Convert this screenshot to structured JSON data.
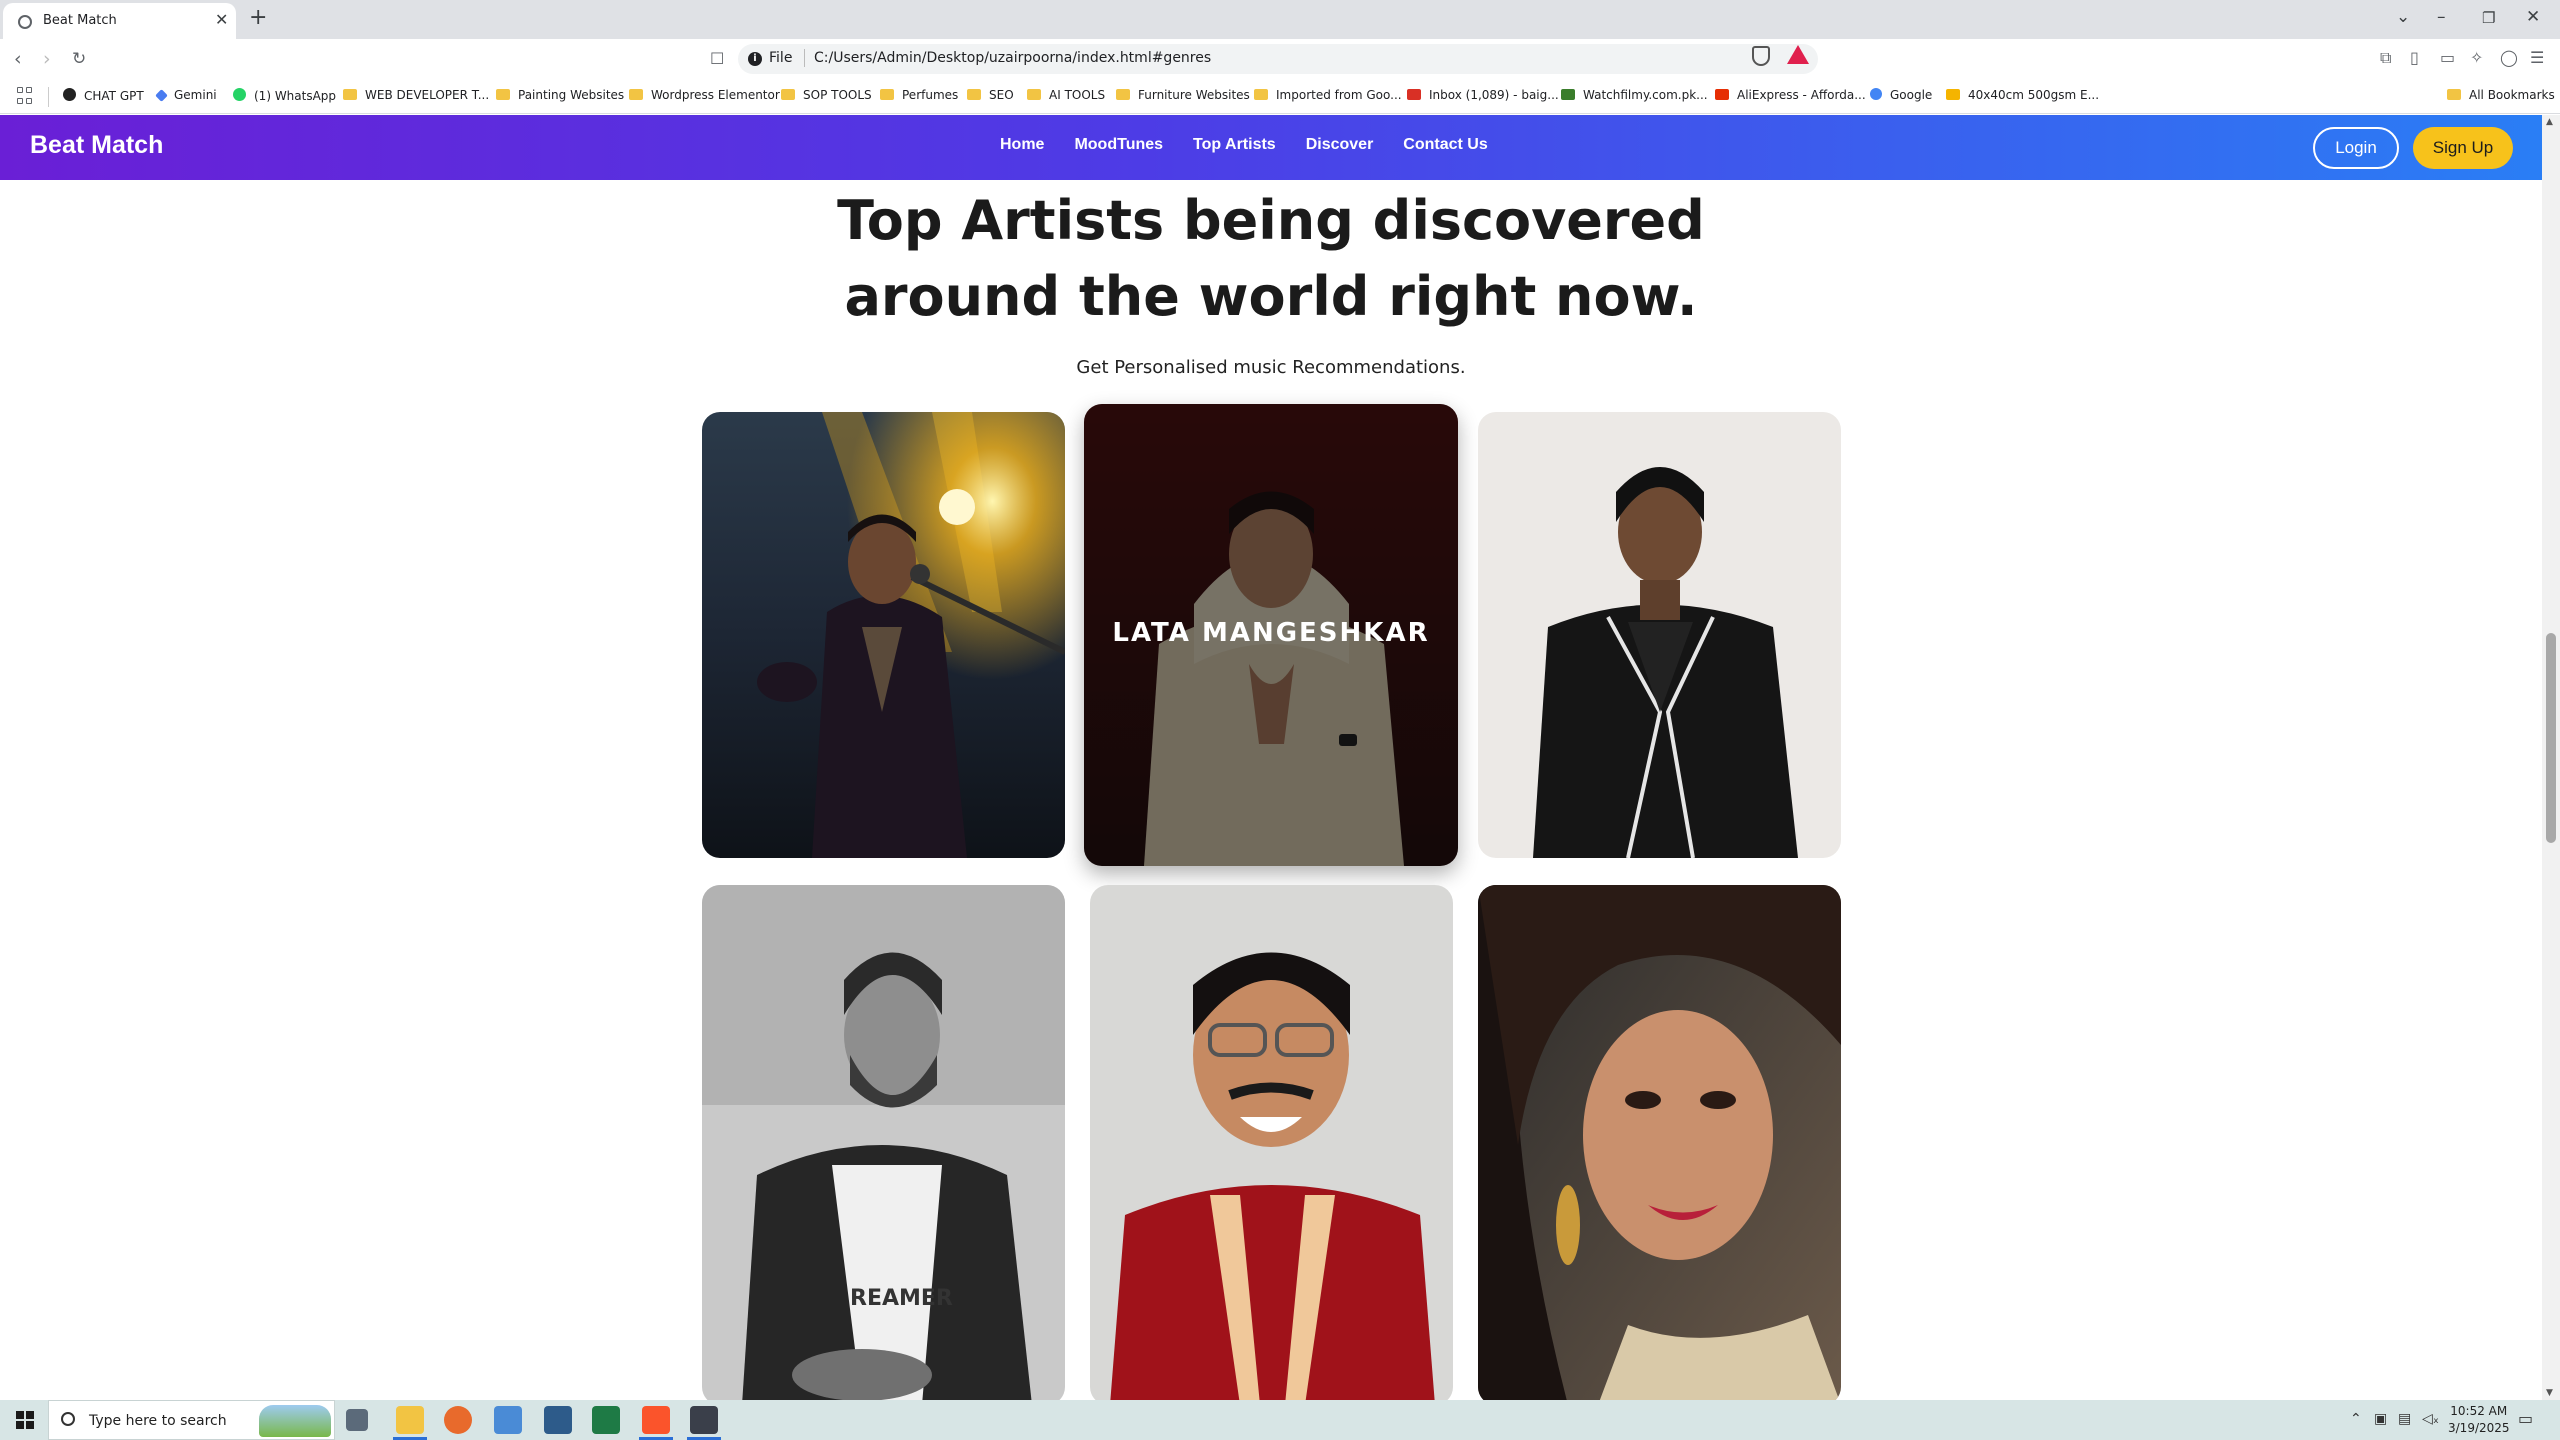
{
  "browser": {
    "tab_title": "Beat Match",
    "address_scheme": "File",
    "url": "C:/Users/Admin/Desktop/uzairpoorna/index.html#genres",
    "bookmarks": [
      "CHAT GPT",
      "Gemini",
      "(1) WhatsApp",
      "WEB DEVELOPER T...",
      "Painting Websites",
      "Wordpress Elementor",
      "SOP TOOLS",
      "Perfumes",
      "SEO",
      "AI TOOLS",
      "Furniture Websites",
      "Imported from Goo...",
      "Inbox (1,089) - baig...",
      "Watchfilmy.com.pk...",
      "AliExpress - Afforda...",
      "Google",
      "40x40cm 500gsm E..."
    ],
    "all_bookmarks": "All Bookmarks"
  },
  "site": {
    "brand": "Beat Match",
    "nav": [
      "Home",
      "MoodTunes",
      "Top Artists",
      "Discover",
      "Contact Us"
    ],
    "login": "Login",
    "signup": "Sign Up",
    "headline_line1": "Top Artists being discovered",
    "headline_line2": "around the world right now.",
    "subheading": "Get Personalised music Recommendations.",
    "hover_caption": "LATA MANGESHKAR",
    "colors": {
      "nav_gradient_start": "#6a1fd6",
      "nav_gradient_end": "#2a7ef5",
      "signup_button": "#f7c21b"
    }
  },
  "taskbar": {
    "search_placeholder": "Type here to search",
    "time": "10:52 AM",
    "date": "3/19/2025"
  }
}
